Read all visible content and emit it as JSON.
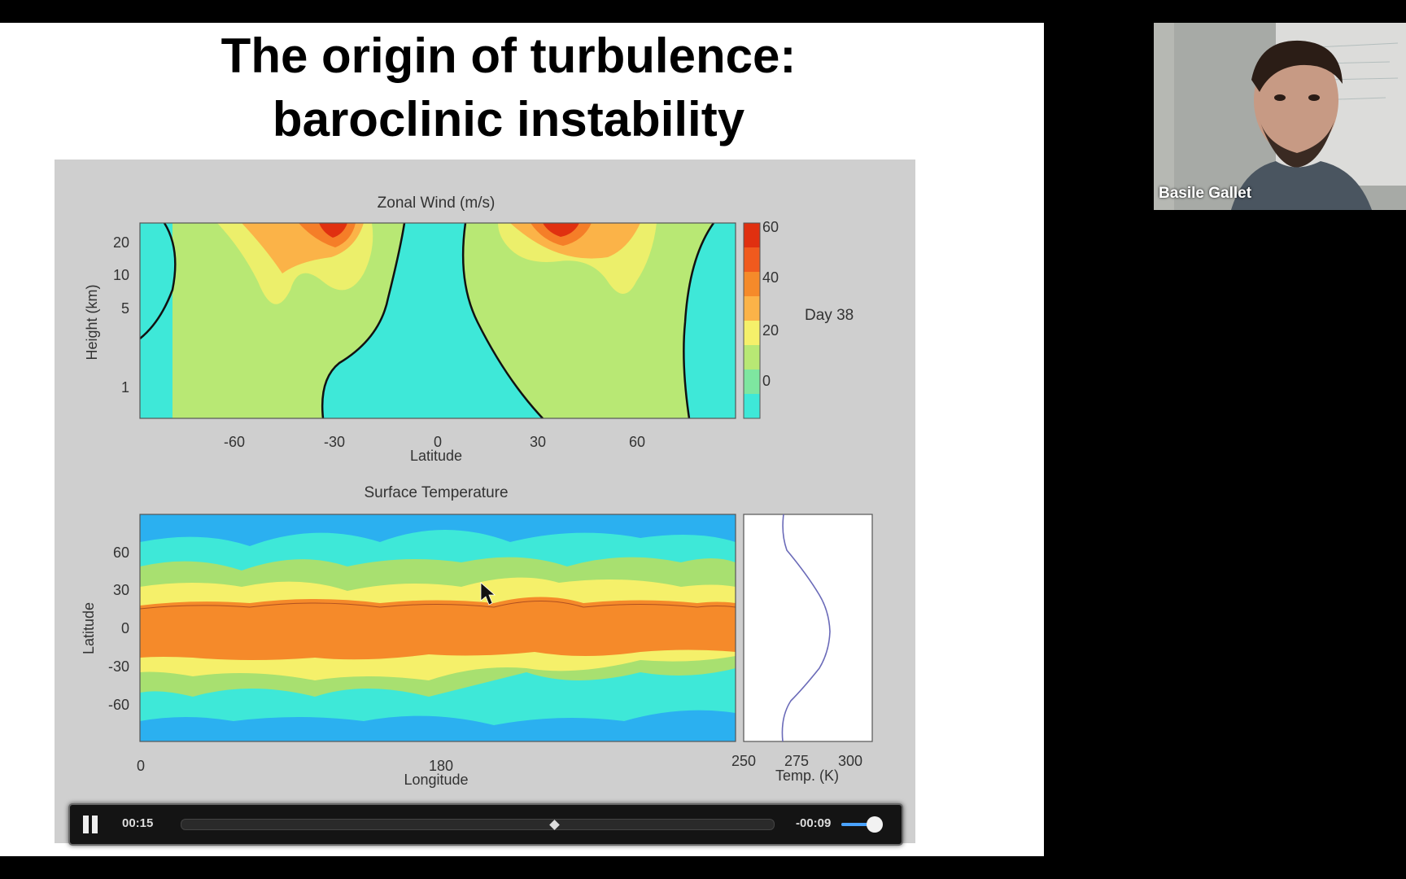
{
  "slide": {
    "title_line1": "The origin of turbulence:",
    "title_line2": "baroclinic instability"
  },
  "figure": {
    "top_title": "Zonal Wind (m/s)",
    "top_ylabel": "Height (km)",
    "top_yticks": [
      "20",
      "10",
      "5",
      "1"
    ],
    "top_xticks": [
      "-60",
      "-30",
      "0",
      "30",
      "60"
    ],
    "top_xlabel": "Latitude",
    "colorbar_ticks": [
      "60",
      "40",
      "20",
      "0"
    ],
    "day_label": "Day 38",
    "bottom_title": "Surface Temperature",
    "bottom_ylabel": "Latitude",
    "bottom_yticks": [
      "60",
      "30",
      "0",
      "-30",
      "-60"
    ],
    "bottom_xticks": [
      "0",
      "180"
    ],
    "bottom_xlabel": "Longitude",
    "profile_xticks": [
      "250",
      "275",
      "300"
    ],
    "profile_xlabel": "Temp. (K)"
  },
  "player": {
    "elapsed": "00:15",
    "remaining": "-00:09",
    "progress": 0.63,
    "volume": 0.82
  },
  "participant": {
    "name": "Basile Gallet"
  },
  "colors": {
    "video_bg": "#cfcfcf",
    "cyan": "#3ee8d8",
    "blue": "#2bb0f0",
    "green": "#a8e070",
    "yellow": "#f5f06a",
    "orange": "#f58a2a",
    "red": "#e03010"
  }
}
